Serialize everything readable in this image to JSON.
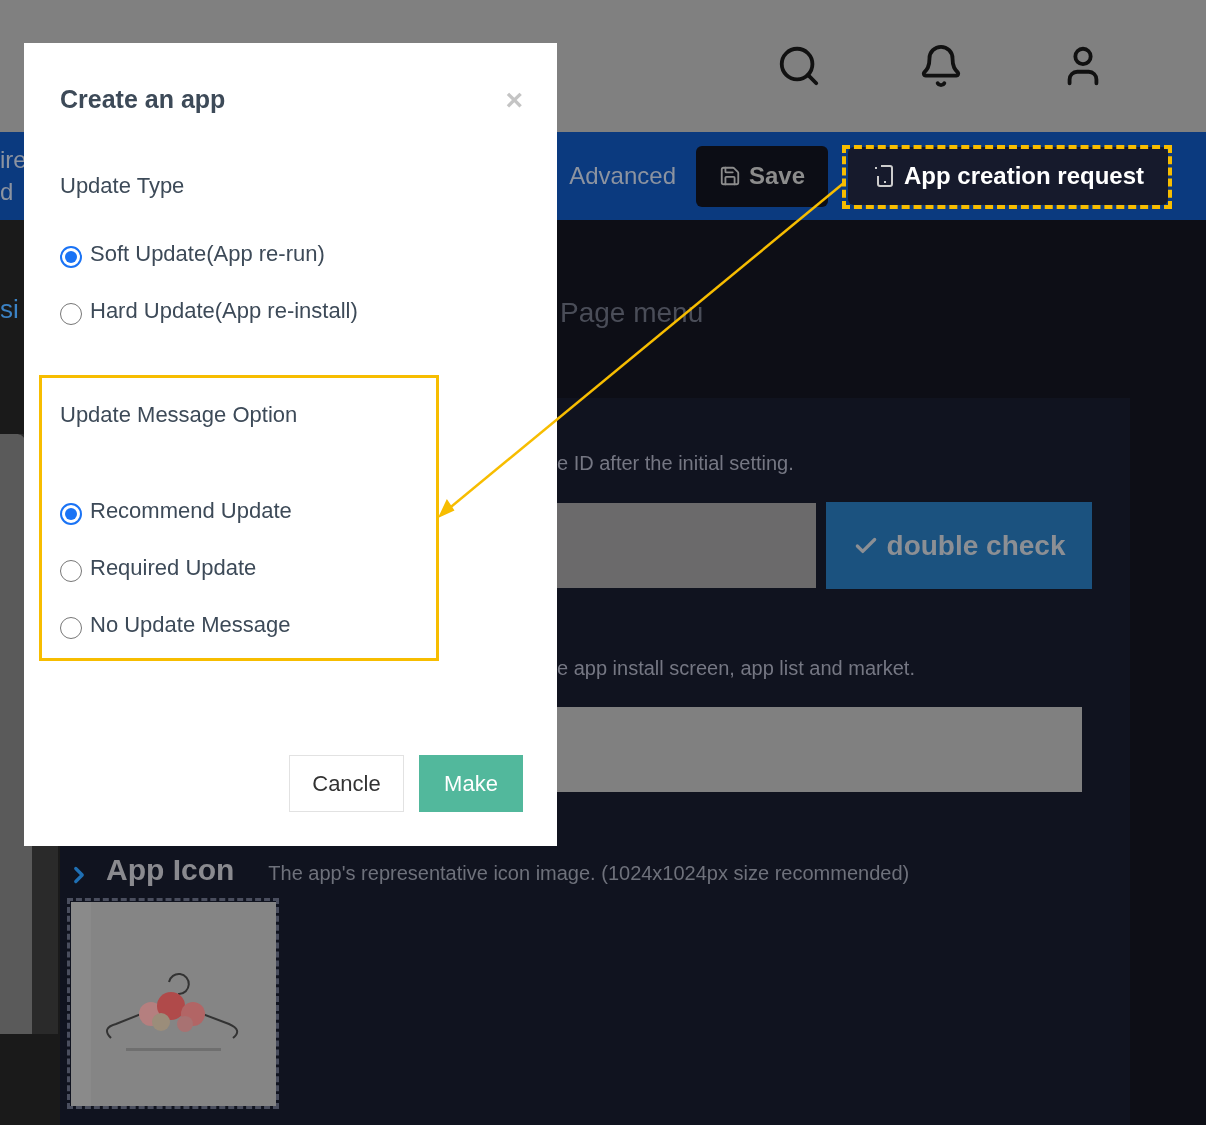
{
  "toolbar": {
    "fragments": [
      "ire",
      "d"
    ],
    "advanced": "Advanced",
    "save": "Save",
    "create_request": "App creation request"
  },
  "sidebar": {
    "fragment": "si"
  },
  "page_menu": "Page menu",
  "form": {
    "id_hint": "e ID after the initial setting.",
    "double_check": "double check",
    "name_hint": "e app install screen, app list and market.",
    "app_icon": {
      "title": "App Icon",
      "description": "The app's representative icon image. (1024x1024px size recommended)"
    }
  },
  "dialog": {
    "title": "Create an app",
    "close": "×",
    "update_type": {
      "label": "Update Type",
      "options": [
        {
          "label": "Soft Update(App re-run)",
          "selected": true
        },
        {
          "label": "Hard Update(App re-install)",
          "selected": false
        }
      ]
    },
    "message_option": {
      "label": "Update Message Option",
      "options": [
        {
          "label": "Recommend Update",
          "selected": true
        },
        {
          "label": "Required Update",
          "selected": false
        },
        {
          "label": "No Update Message",
          "selected": false
        }
      ]
    },
    "buttons": {
      "cancel": "Cancle",
      "make": "Make"
    }
  }
}
